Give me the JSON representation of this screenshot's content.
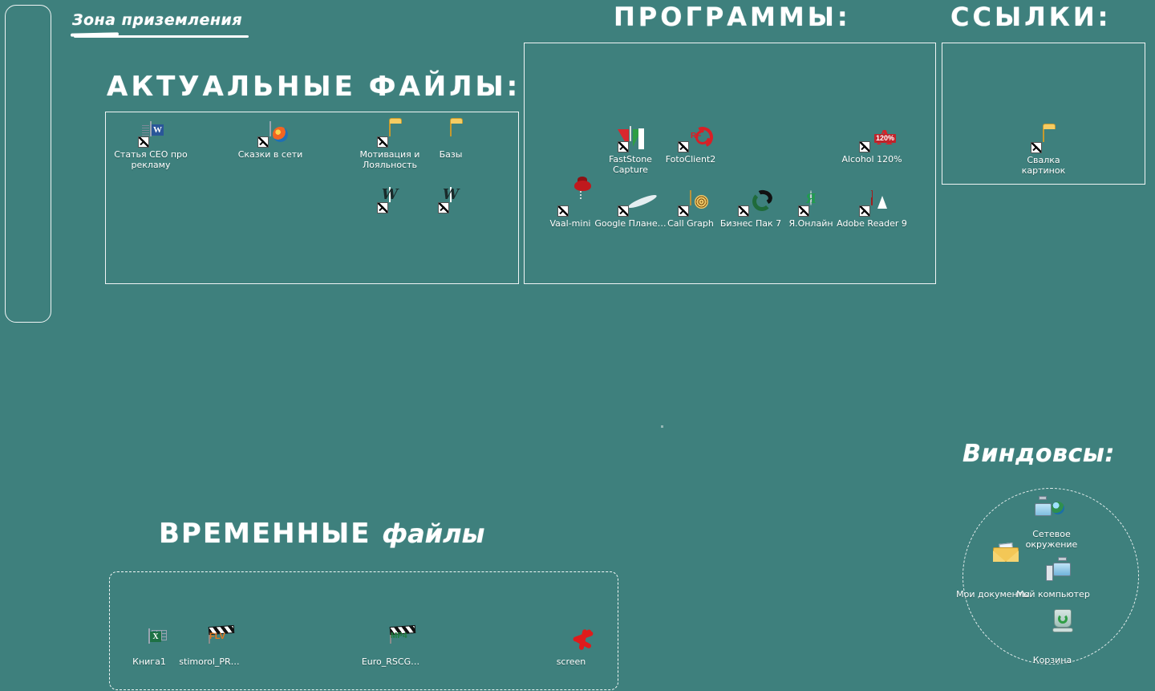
{
  "desktop": {
    "background_color": "#3e807d",
    "text_color": "#ffffff"
  },
  "landing_zone": {
    "label": "Зона приземления",
    "box_name": "landing-zone-box"
  },
  "sections": {
    "actual_files": {
      "heading": "АКТУАЛЬНЫЕ  ФАЙЛЫ:",
      "icons": [
        {
          "label": "Статья СЕО про рекламу",
          "icon": "word-document-icon",
          "shortcut": true
        },
        {
          "label": "Сказки в сети",
          "icon": "firefox-html-document-icon",
          "shortcut": true
        },
        {
          "label": "Мотивация  и Лояльность",
          "icon": "folder-icon",
          "shortcut": true
        },
        {
          "label": "Базы",
          "icon": "folder-icon",
          "shortcut": false
        },
        {
          "label": "",
          "icon": "word-script-shortcut-icon",
          "shortcut": true
        },
        {
          "label": "",
          "icon": "word-script-shortcut-icon",
          "shortcut": true
        }
      ]
    },
    "programs": {
      "heading": "ПРОГРАММЫ:",
      "icons": [
        {
          "label": "FastStone Capture",
          "icon": "faststone-capture-icon",
          "shortcut": true
        },
        {
          "label": "FotoClient2",
          "icon": "fotoclient2-icon",
          "shortcut": true
        },
        {
          "label": "Alcohol 120%",
          "icon": "alcohol-120-icon",
          "shortcut": true
        },
        {
          "label": "Vaal-mini",
          "icon": "vaal-mini-icon",
          "shortcut": true
        },
        {
          "label": "Google Плане…",
          "icon": "google-earth-icon",
          "shortcut": true
        },
        {
          "label": "Call Graph",
          "icon": "call-graph-icon",
          "shortcut": true
        },
        {
          "label": "Бизнес Пак 7",
          "icon": "business-pack-icon",
          "shortcut": true
        },
        {
          "label": "Я.Онлайн",
          "icon": "yandex-online-icon",
          "shortcut": true
        },
        {
          "label": "Adobe Reader 9",
          "icon": "adobe-reader-icon",
          "shortcut": true
        }
      ]
    },
    "links": {
      "heading": "ССЫЛКИ:",
      "icons": [
        {
          "label": "Свалка картинок",
          "icon": "folder-icon",
          "shortcut": true
        }
      ]
    },
    "temp_files": {
      "heading_bold": "ВРЕМЕННЫЕ",
      "heading_soft": "файлы",
      "icons": [
        {
          "label": "Книга1",
          "icon": "excel-document-icon",
          "shortcut": false
        },
        {
          "label": "stimorol_PR…",
          "icon": "flv-video-icon",
          "shortcut": false
        },
        {
          "label": "Euro_RSCG…",
          "icon": "mp4-video-icon",
          "shortcut": false
        },
        {
          "label": "screen",
          "icon": "screen-splat-icon",
          "shortcut": false
        }
      ]
    },
    "windows": {
      "heading": "Виндовсы:",
      "icons": [
        {
          "label": "Сетевое окружение",
          "icon": "network-places-icon",
          "shortcut": false
        },
        {
          "label": "Мои документы",
          "icon": "my-documents-icon",
          "shortcut": false
        },
        {
          "label": "Мой компьютер",
          "icon": "my-computer-icon",
          "shortcut": false
        },
        {
          "label": "Корзина",
          "icon": "recycle-bin-icon",
          "shortcut": false
        }
      ]
    }
  }
}
